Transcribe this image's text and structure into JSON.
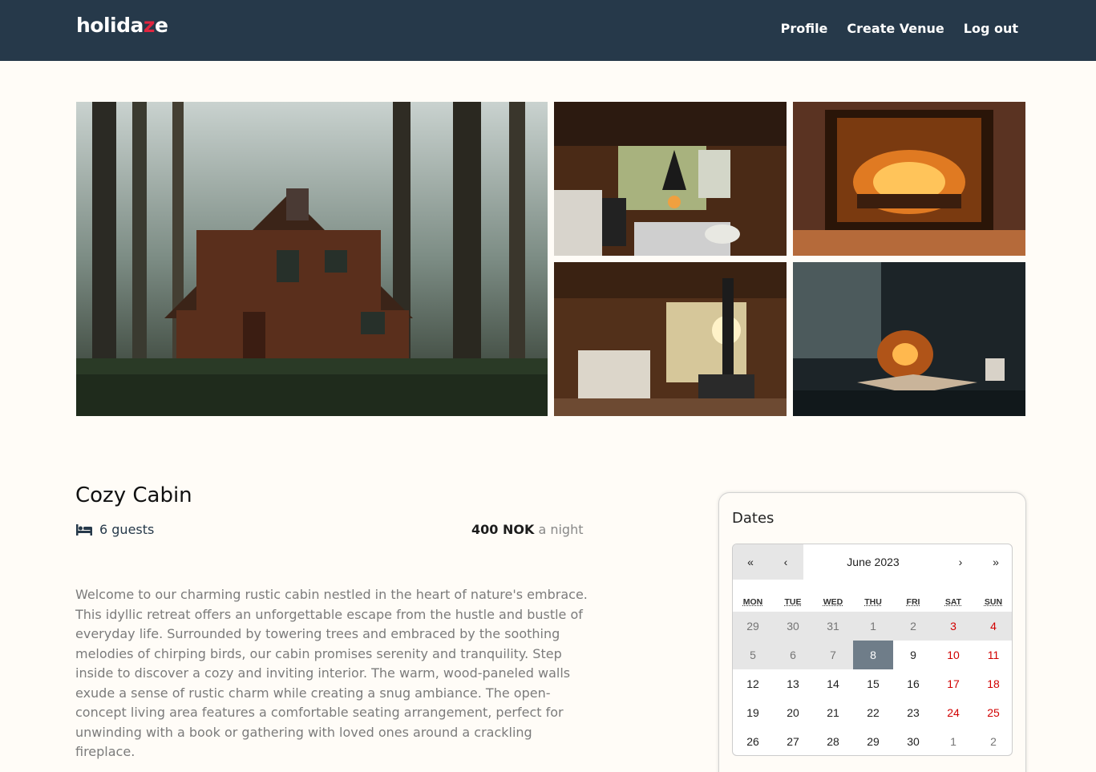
{
  "header": {
    "logo": {
      "part1": "holida",
      "part2": "z",
      "part3": "e"
    },
    "nav": [
      "Profile",
      "Create Venue",
      "Log out"
    ]
  },
  "gallery": {
    "images": [
      {
        "name": "cabin-exterior-photo"
      },
      {
        "name": "cabin-living-room-photo"
      },
      {
        "name": "fireplace-photo"
      },
      {
        "name": "cabin-kitchen-photo"
      },
      {
        "name": "book-by-fire-photo"
      }
    ]
  },
  "venue": {
    "title": "Cozy Cabin",
    "guests": "6 guests",
    "guests_icon": "bed-icon",
    "price": "400 NOK",
    "price_suffix": " a night",
    "description": "Welcome to our charming rustic cabin nestled in the heart of nature's embrace. This idyllic retreat offers an unforgettable escape from the hustle and bustle of everyday life. Surrounded by towering trees and embraced by the soothing melodies of chirping birds, our cabin promises serenity and tranquility. Step inside to discover a cozy and inviting interior. The warm, wood-paneled walls exude a sense of rustic charm while creating a snug ambiance. The open-concept living area features a comfortable seating arrangement, perfect for unwinding with a book or gathering with loved ones around a crackling fireplace."
  },
  "booking": {
    "title": "Dates",
    "calendar": {
      "month_label": "June 2023",
      "prev_year": "«",
      "prev_month": "‹",
      "next_month": "›",
      "next_year": "»",
      "weekdays": [
        "MON",
        "TUE",
        "WED",
        "THU",
        "FRI",
        "SAT",
        "SUN"
      ],
      "days": [
        {
          "d": "29",
          "past": true,
          "neighbor": true
        },
        {
          "d": "30",
          "past": true,
          "neighbor": true
        },
        {
          "d": "31",
          "past": true,
          "neighbor": true
        },
        {
          "d": "1",
          "past": true
        },
        {
          "d": "2",
          "past": true
        },
        {
          "d": "3",
          "past": true,
          "weekend": true
        },
        {
          "d": "4",
          "past": true,
          "weekend": true
        },
        {
          "d": "5",
          "past": true
        },
        {
          "d": "6",
          "past": true
        },
        {
          "d": "7",
          "past": true
        },
        {
          "d": "8",
          "today": true
        },
        {
          "d": "9"
        },
        {
          "d": "10",
          "weekend": true
        },
        {
          "d": "11",
          "weekend": true
        },
        {
          "d": "12"
        },
        {
          "d": "13"
        },
        {
          "d": "14"
        },
        {
          "d": "15"
        },
        {
          "d": "16"
        },
        {
          "d": "17",
          "weekend": true
        },
        {
          "d": "18",
          "weekend": true
        },
        {
          "d": "19"
        },
        {
          "d": "20"
        },
        {
          "d": "21"
        },
        {
          "d": "22"
        },
        {
          "d": "23"
        },
        {
          "d": "24",
          "weekend": true
        },
        {
          "d": "25",
          "weekend": true
        },
        {
          "d": "26"
        },
        {
          "d": "27"
        },
        {
          "d": "28"
        },
        {
          "d": "29"
        },
        {
          "d": "30"
        },
        {
          "d": "1",
          "neighbor": true
        },
        {
          "d": "2",
          "neighbor": true
        }
      ]
    }
  },
  "colors": {
    "header_bg": "#26394a",
    "accent": "#e0253f",
    "weekend": "#d10000",
    "today_bg": "#6f7d89"
  }
}
